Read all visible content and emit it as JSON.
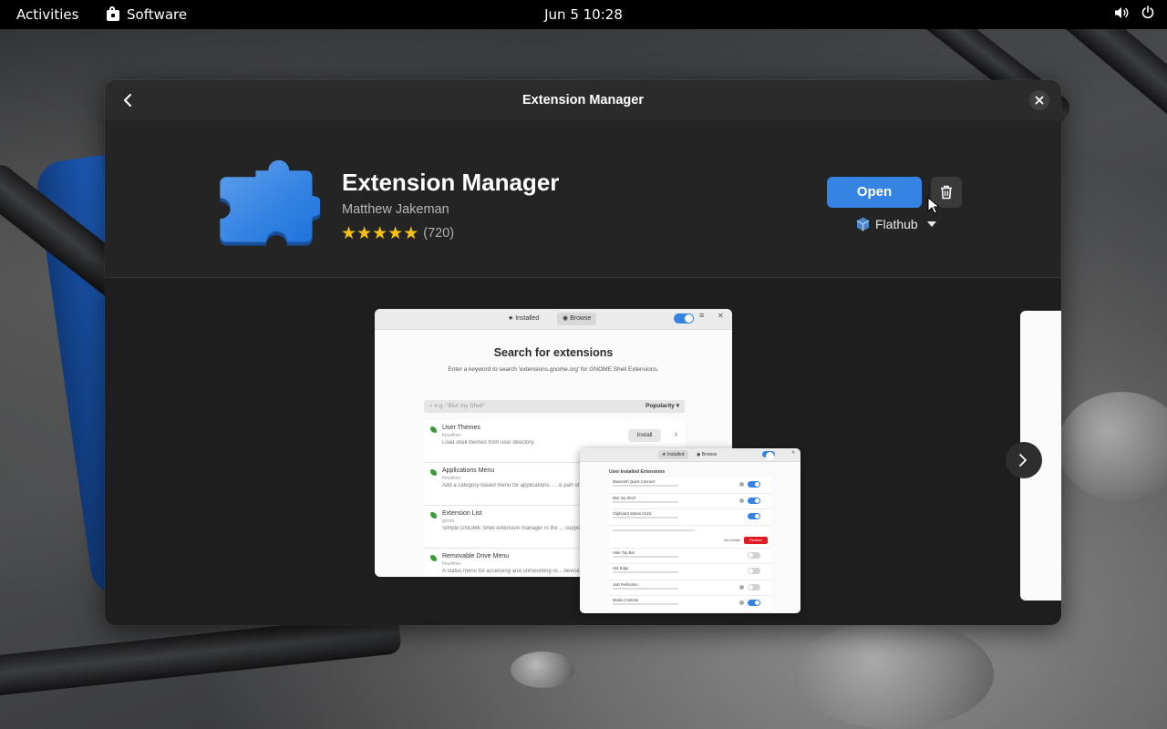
{
  "topbar": {
    "activities": "Activities",
    "app_name": "Software",
    "clock": "Jun 5  10:28"
  },
  "window": {
    "title": "Extension Manager"
  },
  "app": {
    "name": "Extension Manager",
    "developer": "Matthew Jakeman",
    "rating_stars": 5,
    "rating_count": "(720)",
    "open_label": "Open",
    "source": "Flathub"
  },
  "screenshot1": {
    "tab_installed": "Installed",
    "tab_browse": "Browse",
    "title": "Search for extensions",
    "subtitle": "Enter a keyword to search 'extensions.gnome.org' for GNOME Shell Extensions.",
    "search_placeholder": "e.g. \"Blur my Shell\"",
    "sort": "Popularity",
    "install_label": "Install",
    "items": [
      {
        "title": "User Themes",
        "author": "fmuellner",
        "desc": "Load shell themes from user directory."
      },
      {
        "title": "Applications Menu",
        "author": "fmuellner",
        "desc": "Add a category-based menu for applications. ... is part of Classic Mode and is officially supported"
      },
      {
        "title": "Extension List",
        "author": "grroot",
        "desc": "Simple GNOME Shell extension manager in the ... support, please report any issues via the homepage"
      },
      {
        "title": "Removable Drive Menu",
        "author": "fmuellner",
        "desc": "A status menu for accessing and unmounting re... devices."
      }
    ]
  },
  "screenshot2": {
    "tab_installed": "Installed",
    "tab_browse": "Browse",
    "section": "User-Installed Extensions",
    "see_details": "See Details",
    "remove": "Remove",
    "rows": [
      {
        "title": "Bluetooth Quick Connect",
        "on": true
      },
      {
        "title": "Blur my Shell",
        "on": true
      },
      {
        "title": "Clipboard Status Clock",
        "on": true
      },
      {
        "title": "Hide Top Bar",
        "on": false
      },
      {
        "title": "Hot Edge",
        "on": false
      },
      {
        "title": "Just Perfection",
        "on": false
      },
      {
        "title": "Media Controls",
        "on": true
      }
    ]
  },
  "colors": {
    "accent": "#3584e4",
    "star": "#f5c211",
    "destructive": "#e01b24"
  }
}
